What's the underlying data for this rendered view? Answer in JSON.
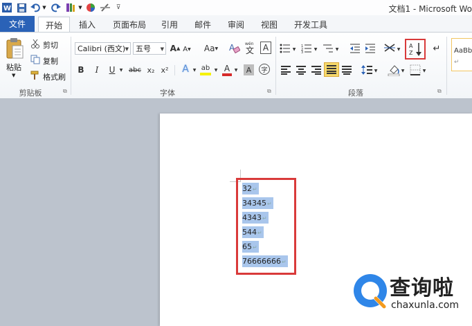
{
  "window": {
    "title": "文档1 - Microsoft Wo"
  },
  "tabs": {
    "file": "文件",
    "home": "开始",
    "insert": "插入",
    "page_layout": "页面布局",
    "references": "引用",
    "mailings": "邮件",
    "review": "审阅",
    "view": "视图",
    "developer": "开发工具"
  },
  "clipboard": {
    "paste": "粘贴",
    "cut": "剪切",
    "copy": "复制",
    "format_painter": "格式刷",
    "group": "剪贴板"
  },
  "font": {
    "name": "Calibri (西文)",
    "size": "五号",
    "group": "字体",
    "bold": "B",
    "italic": "I",
    "underline": "U",
    "strike": "abc",
    "subscript": "x₂",
    "superscript": "x²",
    "change_case": "Aa",
    "grow": "A",
    "shrink": "A",
    "clear": "A",
    "phonetic": "wén",
    "char_border": "A",
    "effects": "A",
    "highlight": "ab",
    "font_color": "A",
    "char_shading": "A",
    "enclose": "字"
  },
  "paragraph": {
    "group": "段落",
    "sort_icon_top": "A",
    "sort_icon_bottom": "Z"
  },
  "styles": {
    "preview": "AaBb"
  },
  "document": {
    "lines": [
      "32",
      "34345",
      "4343",
      "544",
      "65",
      "76666666"
    ]
  },
  "watermark": {
    "brand": "查询啦",
    "url": "chaxunla.com"
  },
  "colors": {
    "accent_blue": "#2a62b7",
    "selection": "#a9c6ec",
    "highlight_red": "#d83a3a"
  }
}
